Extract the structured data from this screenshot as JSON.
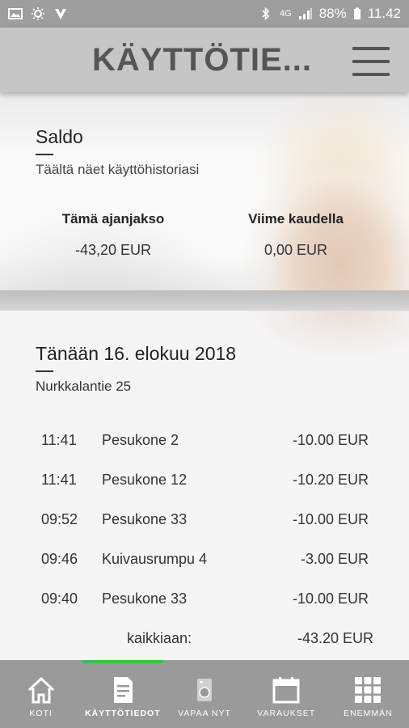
{
  "status_bar": {
    "left_icons": [
      "image-icon",
      "brightness-icon",
      "vpn-icon"
    ],
    "bluetooth": "bluetooth-icon",
    "network": "4G",
    "battery": "88%",
    "time": "11.42"
  },
  "header": {
    "title": "KÄYTTÖTIE...",
    "menu_icon": "hamburger-menu-icon"
  },
  "saldo": {
    "title": "Saldo",
    "subtitle": "Täältä näet käyttöhistoriasi",
    "current_period_label": "Tämä ajanjakso",
    "current_period_value": "-43,20 EUR",
    "last_period_label": "Viime kaudella",
    "last_period_value": "0,00 EUR"
  },
  "history": {
    "date_title": "Tänään 16. elokuu 2018",
    "address": "Nurkkalantie 25",
    "transactions": [
      {
        "time": "11:41",
        "name": "Pesukone 2",
        "amount": "-10.00 EUR"
      },
      {
        "time": "11:41",
        "name": "Pesukone 12",
        "amount": "-10.20 EUR"
      },
      {
        "time": "09:52",
        "name": "Pesukone 33",
        "amount": "-10.00 EUR"
      },
      {
        "time": "09:46",
        "name": "Kuivausrumpu 4",
        "amount": "-3.00 EUR"
      },
      {
        "time": "09:40",
        "name": "Pesukone 33",
        "amount": "-10.00 EUR"
      }
    ],
    "total_label": "kaikkiaan:",
    "total_value": "-43.20 EUR"
  },
  "bottom_nav": {
    "items": [
      {
        "label": "KOTI",
        "icon": "home-icon"
      },
      {
        "label": "KÄYTTÖTIEDOT",
        "icon": "document-icon",
        "active": true
      },
      {
        "label": "VAPAA NYT",
        "icon": "washing-machine-icon"
      },
      {
        "label": "VARAUKSET",
        "icon": "calendar-icon"
      },
      {
        "label": "ENEMMÄN",
        "icon": "grid-icon"
      }
    ],
    "active_color": "#3fbf4a"
  }
}
